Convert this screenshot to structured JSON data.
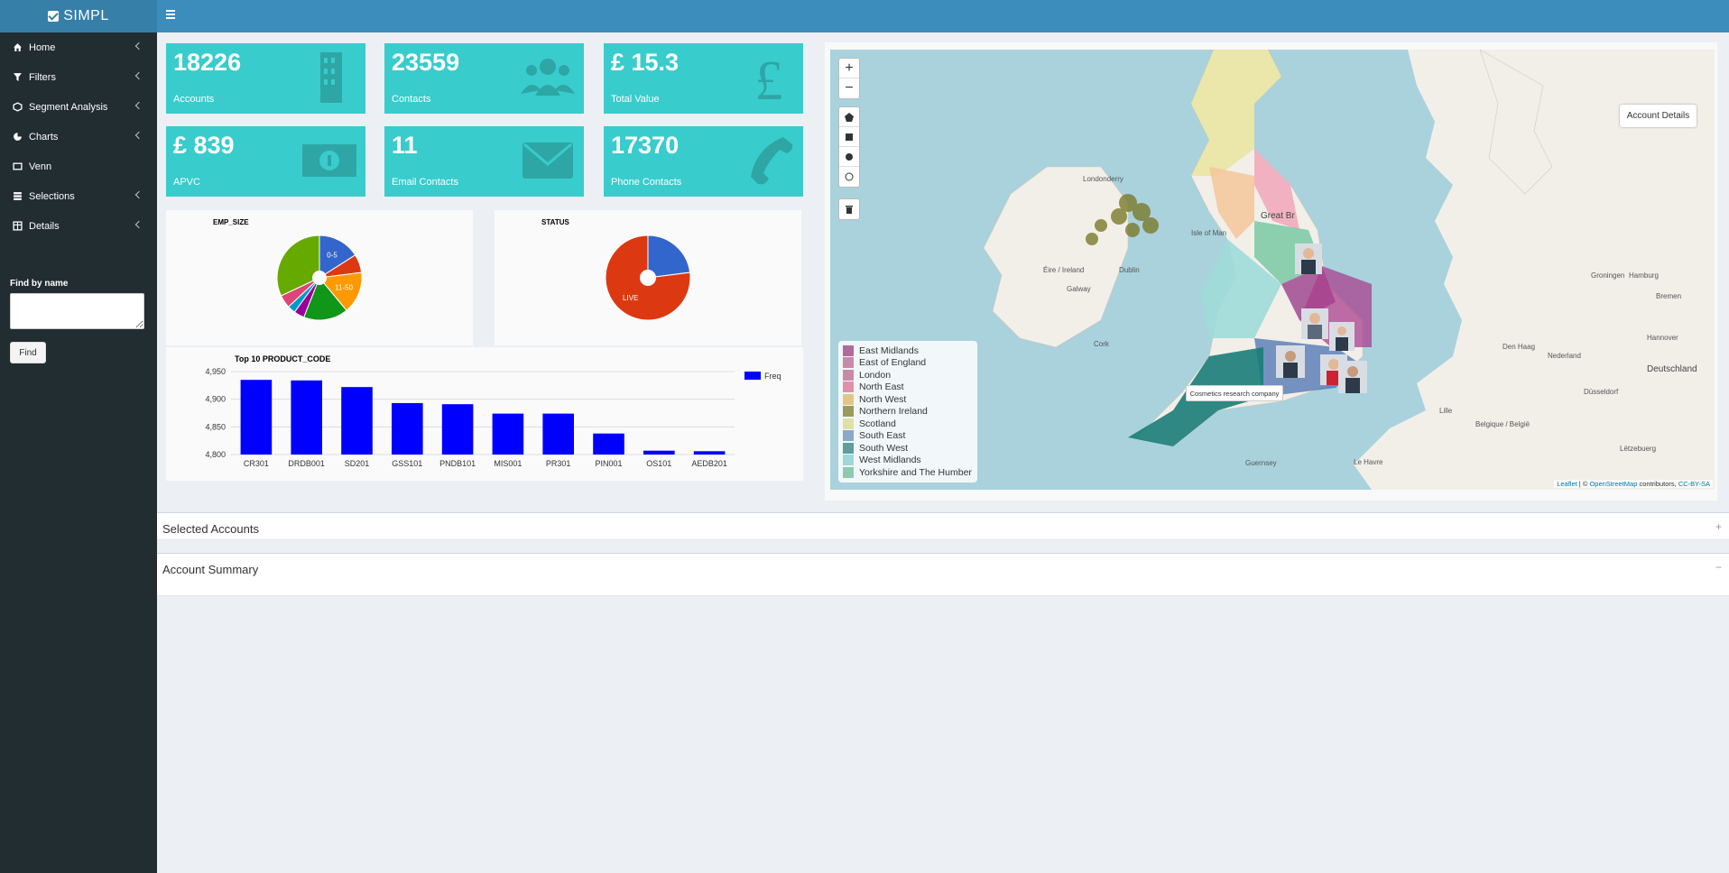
{
  "app": {
    "title": "SIMPL"
  },
  "sidebar": {
    "items": [
      {
        "label": "Home",
        "icon": "home-icon"
      },
      {
        "label": "Filters",
        "icon": "filter-icon"
      },
      {
        "label": "Segment Analysis",
        "icon": "cube-icon"
      },
      {
        "label": "Charts",
        "icon": "pie-chart-icon"
      },
      {
        "label": "Venn",
        "icon": "venn-icon"
      },
      {
        "label": "Selections",
        "icon": "database-icon"
      },
      {
        "label": "Details",
        "icon": "table-icon"
      }
    ],
    "find_label": "Find by name",
    "find_value": "",
    "find_button": "Find"
  },
  "value_boxes": [
    {
      "value": "18226",
      "label": "Accounts",
      "icon": "building-icon"
    },
    {
      "value": "23559",
      "label": "Contacts",
      "icon": "users-icon"
    },
    {
      "value": "£ 15.3",
      "label": "Total Value",
      "icon": "pound-icon"
    },
    {
      "value": "£ 839",
      "label": "APVC",
      "icon": "money-icon"
    },
    {
      "value": "11",
      "label": "Email Contacts",
      "icon": "envelope-icon"
    },
    {
      "value": "17370",
      "label": "Phone Contacts",
      "icon": "phone-icon"
    }
  ],
  "colors": {
    "accent": "#39cccc",
    "header": "#3c8dbc",
    "sidebar": "#222d32",
    "bar": "#0000ff"
  },
  "chart_data": [
    {
      "type": "pie",
      "title": "EMP_SIZE",
      "slices": [
        {
          "label": "0-5",
          "value": 16,
          "color": "#3366cc"
        },
        {
          "label": "",
          "value": 7,
          "color": "#dc3912"
        },
        {
          "label": "11-50",
          "value": 16,
          "color": "#ff9900"
        },
        {
          "label": "",
          "value": 17,
          "color": "#109618"
        },
        {
          "label": "",
          "value": 4,
          "color": "#990099"
        },
        {
          "label": "",
          "value": 3,
          "color": "#0099c6"
        },
        {
          "label": "",
          "value": 5,
          "color": "#dd4477"
        },
        {
          "label": "",
          "value": 32,
          "color": "#66aa00"
        }
      ]
    },
    {
      "type": "pie",
      "title": "STATUS",
      "slices": [
        {
          "label": "",
          "value": 23,
          "color": "#3366cc"
        },
        {
          "label": "LIVE",
          "value": 77,
          "color": "#dc3912"
        }
      ]
    },
    {
      "type": "bar",
      "title": "Top 10 PRODUCT_CODE",
      "categories": [
        "CR301",
        "DRDB001",
        "SD201",
        "GSS101",
        "PNDB101",
        "MIS001",
        "PR301",
        "PIN001",
        "OS101",
        "AEDB201"
      ],
      "series": [
        {
          "name": "Freq",
          "values": [
            4935,
            4934,
            4922,
            4893,
            4891,
            4874,
            4874,
            4838,
            4807,
            4806
          ]
        }
      ],
      "yticks": [
        "4,950",
        "4,900",
        "4,850",
        "4,800"
      ],
      "ylim": [
        4800,
        4950
      ]
    }
  ],
  "map": {
    "zoom_in": "+",
    "zoom_out": "−",
    "account_details": "Account Details",
    "tooltip": "Cosmetics research company",
    "legend": [
      {
        "label": "East Midlands",
        "color": "#b06a9c"
      },
      {
        "label": "East of England",
        "color": "#c78aa9"
      },
      {
        "label": "London",
        "color": "#c98aaa"
      },
      {
        "label": "North East",
        "color": "#e090a9"
      },
      {
        "label": "North West",
        "color": "#e2c784"
      },
      {
        "label": "Northern Ireland",
        "color": "#9a9a5c"
      },
      {
        "label": "Scotland",
        "color": "#e0e0a6"
      },
      {
        "label": "South East",
        "color": "#8aa8c8"
      },
      {
        "label": "South West",
        "color": "#5f9e9e"
      },
      {
        "label": "West Midlands",
        "color": "#9fd8d5"
      },
      {
        "label": "Yorkshire and The Humber",
        "color": "#8fcab0"
      }
    ],
    "labels": {
      "isle_of_man": "Isle of Man",
      "dublin": "Dublin",
      "eire": "Éire / Ireland",
      "great_britain": "Great Br",
      "nederland": "Nederland",
      "deutschland": "Deutschland",
      "belgique": "Belgique / België",
      "london_derry": "Londonderry",
      "cork": "Cork",
      "galway": "Galway",
      "groningen": "Groningen",
      "bremen": "Bremen",
      "hamburg": "Hamburg",
      "hannover": "Hannover",
      "den_haag": "Den Haag",
      "dusseldorf": "Düsseldorf",
      "lille": "Lille",
      "luxembourg": "Lëtzebuerg",
      "guernsey": "Guernsey",
      "le_havre": "Le Havre"
    },
    "attribution": {
      "leaflet": "Leaflet",
      "text": " | © ",
      "osm": "OpenStreetMap",
      "contrib": " contributors, ",
      "license": "CC-BY-SA"
    }
  },
  "sections": {
    "selected_accounts": {
      "title": "Selected Accounts",
      "toggle": "+"
    },
    "account_summary": {
      "title": "Account Summary",
      "toggle": "−"
    }
  }
}
